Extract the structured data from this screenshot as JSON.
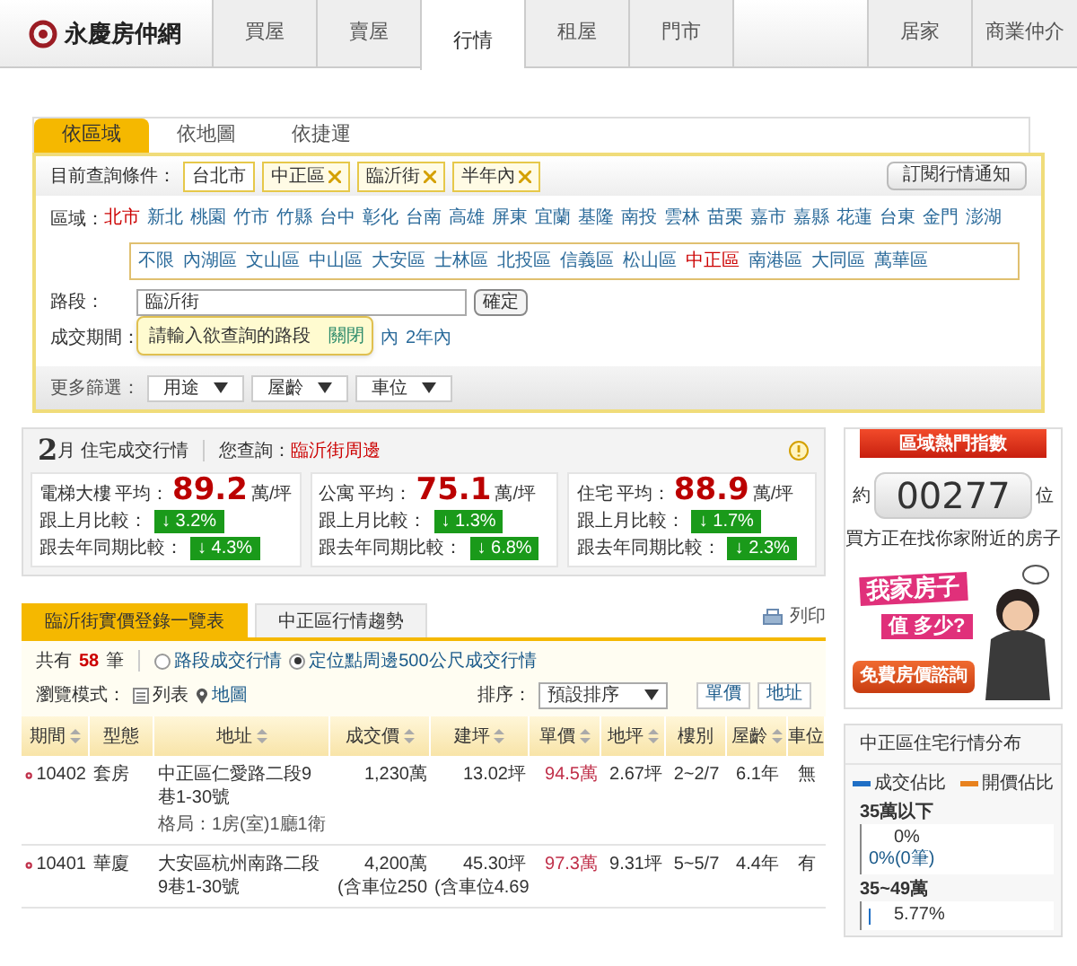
{
  "nav": {
    "logo": "永慶房仲網",
    "tabs": [
      {
        "label": "買屋",
        "selected": false
      },
      {
        "label": "賣屋",
        "selected": false
      },
      {
        "label": "行情",
        "selected": true
      },
      {
        "label": "租屋",
        "selected": false
      },
      {
        "label": "門市",
        "selected": false
      },
      {
        "kind": "blank"
      },
      {
        "label": "居家",
        "selected": false
      },
      {
        "label": "商業仲介",
        "selected": false
      }
    ]
  },
  "search": {
    "tabs": [
      {
        "label": "依區域",
        "selected": true
      },
      {
        "label": "依地圖",
        "selected": false
      },
      {
        "label": "依捷運",
        "selected": false
      }
    ],
    "conditions_label": "目前查詢條件：",
    "chips": [
      {
        "label": "台北市",
        "removable": false
      },
      {
        "label": "中正區",
        "removable": true
      },
      {
        "label": "臨沂街",
        "removable": true
      },
      {
        "label": "半年內",
        "removable": true
      }
    ],
    "subscribe_button": "訂閱行情通知",
    "region_label": "區域：",
    "cities": [
      {
        "label": "北市",
        "selected": true
      },
      {
        "label": "新北",
        "selected": false
      },
      {
        "label": "桃園",
        "selected": false
      },
      {
        "label": "竹市",
        "selected": false
      },
      {
        "label": "竹縣",
        "selected": false
      },
      {
        "label": "台中",
        "selected": false
      },
      {
        "label": "彰化",
        "selected": false
      },
      {
        "label": "台南",
        "selected": false
      },
      {
        "label": "高雄",
        "selected": false
      },
      {
        "label": "屏東",
        "selected": false
      },
      {
        "label": "宜蘭",
        "selected": false
      },
      {
        "label": "基隆",
        "selected": false
      },
      {
        "label": "南投",
        "selected": false
      },
      {
        "label": "雲林",
        "selected": false
      },
      {
        "label": "苗栗",
        "selected": false
      },
      {
        "label": "嘉市",
        "selected": false
      },
      {
        "label": "嘉縣",
        "selected": false
      },
      {
        "label": "花蓮",
        "selected": false
      },
      {
        "label": "台東",
        "selected": false
      },
      {
        "label": "金門",
        "selected": false
      },
      {
        "label": "澎湖",
        "selected": false
      }
    ],
    "districts": [
      {
        "label": "不限",
        "selected": false
      },
      {
        "label": "內湖區",
        "selected": false
      },
      {
        "label": "文山區",
        "selected": false
      },
      {
        "label": "中山區",
        "selected": false
      },
      {
        "label": "大安區",
        "selected": false
      },
      {
        "label": "士林區",
        "selected": false
      },
      {
        "label": "北投區",
        "selected": false
      },
      {
        "label": "信義區",
        "selected": false
      },
      {
        "label": "松山區",
        "selected": false
      },
      {
        "label": "中正區",
        "selected": true
      },
      {
        "label": "南港區",
        "selected": false
      },
      {
        "label": "大同區",
        "selected": false
      },
      {
        "label": "萬華區",
        "selected": false
      }
    ],
    "road_label": "路段：",
    "road_value": "臨沂街",
    "confirm_button": "確定",
    "period_label": "成交期間：",
    "periods": [
      "內",
      "2年內"
    ],
    "tooltip": {
      "text": "請輸入欲查詢的路段",
      "close": "關閉"
    },
    "more_label": "更多篩選：",
    "filters": [
      "用途",
      "屋齡",
      "車位"
    ]
  },
  "stats": {
    "month": "2",
    "title": "月 住宅成交行情",
    "query_label": "您查詢：",
    "query_value": "臨沂街周邊",
    "cards": [
      {
        "type": "電梯大樓",
        "avg_label": "平均：",
        "price": "89.2",
        "unit": "萬/坪",
        "mom_label": "跟上月比較：",
        "mom": "↓ 3.2%",
        "yoy_label": "跟去年同期比較：",
        "yoy": "↓ 4.3%"
      },
      {
        "type": "公寓",
        "avg_label": "平均：",
        "price": "75.1",
        "unit": "萬/坪",
        "mom_label": "跟上月比較：",
        "mom": "↓ 1.3%",
        "yoy_label": "跟去年同期比較：",
        "yoy": "↓ 6.8%"
      },
      {
        "type": "住宅",
        "avg_label": "平均：",
        "price": "88.9",
        "unit": "萬/坪",
        "mom_label": "跟上月比較：",
        "mom": "↓ 1.7%",
        "yoy_label": "跟去年同期比較：",
        "yoy": "↓ 2.3%"
      }
    ]
  },
  "listing": {
    "tabs": [
      {
        "label": "臨沂街實價登錄一覽表",
        "selected": true
      },
      {
        "label": "中正區行情趨勢",
        "selected": false
      }
    ],
    "print": "列印",
    "count_prefix": "共有",
    "count": "58",
    "count_suffix": "筆",
    "modes": [
      {
        "label": "路段成交行情",
        "selected": false
      },
      {
        "label": "定位點周邊500公尺成交行情",
        "selected": true
      }
    ],
    "view_label": "瀏覽模式：",
    "views": [
      {
        "label": "列表",
        "kind": "list"
      },
      {
        "label": "地圖",
        "kind": "map"
      }
    ],
    "sort_label": "排序：",
    "sort_value": "預設排序",
    "sort_buttons": [
      "單價",
      "地址"
    ],
    "columns": [
      {
        "label": "期間",
        "sortable": true
      },
      {
        "label": "型態",
        "sortable": false
      },
      {
        "label": "地址",
        "sortable": true
      },
      {
        "label": "成交價",
        "sortable": true
      },
      {
        "label": "建坪",
        "sortable": true
      },
      {
        "label": "單價",
        "sortable": true,
        "accent": true
      },
      {
        "label": "地坪",
        "sortable": true
      },
      {
        "label": "樓別",
        "sortable": false
      },
      {
        "label": "屋齡",
        "sortable": true
      },
      {
        "label": "車位",
        "sortable": false
      }
    ],
    "rows": [
      {
        "cells": [
          "10402",
          "套房",
          "中正區仁愛路二段9巷1-30號",
          "1,230萬",
          "13.02坪",
          "94.5萬",
          "2.67坪",
          "2~2/7",
          "6.1年",
          "無"
        ],
        "layout": "格局：1房(室)1廳1衛",
        "price_note": null,
        "area_note": null
      },
      {
        "cells": [
          "10401",
          "華廈",
          "大安區杭州南路二段9巷1-30號",
          "4,200萬",
          "45.30坪",
          "97.3萬",
          "9.31坪",
          "5~5/7",
          "4.4年",
          "有"
        ],
        "price_note": "(含車位250",
        "area_note": "(含車位4.69"
      }
    ]
  },
  "sidebar": {
    "hot": {
      "title": "區域熱門指數",
      "prefix": "約",
      "count": "00277",
      "suffix": "位",
      "caption": "買方正在找你家附近的房子"
    },
    "ad": {
      "headline": "我家房子",
      "sub": "值 多少?",
      "cta": "免費房價諮詢"
    },
    "distribution": {
      "title": "中正區住宅行情分布",
      "legend": [
        {
          "label": "成交佔比",
          "color": "#1f6fc5"
        },
        {
          "label": "開價佔比",
          "color": "#e8821e"
        }
      ],
      "groups": [
        {
          "label": "35萬以下",
          "deal": "0%",
          "level": 0,
          "ask": "0%(0筆)"
        },
        {
          "label": "35~49萬",
          "deal": "5.77%",
          "level": 0.1
        }
      ]
    }
  }
}
